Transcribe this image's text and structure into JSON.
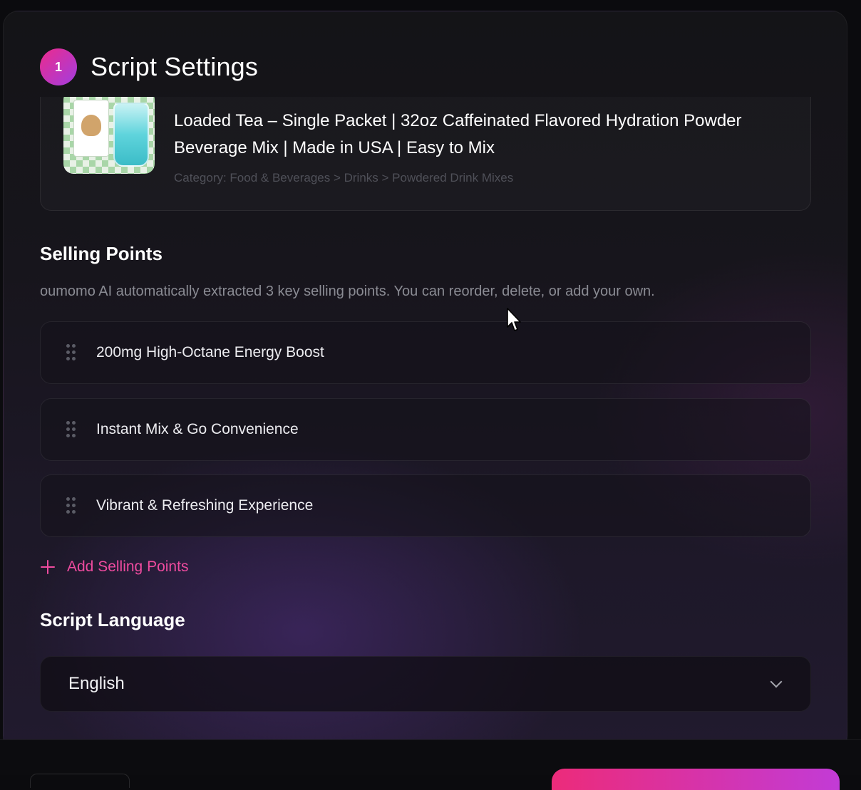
{
  "header": {
    "step_number": "1",
    "title": "Script Settings"
  },
  "product": {
    "title": "Loaded Tea – Single Packet | 32oz Caffeinated Flavored Hydration Powder Beverage Mix | Made in USA | Easy to Mix",
    "category": "Category: Food & Beverages > Drinks > Powdered Drink Mixes"
  },
  "selling_points": {
    "title": "Selling Points",
    "description": "oumomo AI automatically extracted 3 key selling points. You can reorder, delete, or add your own.",
    "items": [
      {
        "label": "200mg High-Octane Energy Boost"
      },
      {
        "label": "Instant Mix & Go Convenience"
      },
      {
        "label": "Vibrant & Refreshing Experience"
      }
    ],
    "add_label": "Add Selling Points"
  },
  "language": {
    "title": "Script Language",
    "selected": "English"
  },
  "colors": {
    "accent_pink": "#ef4b9f",
    "badge_gradient_start": "#ec2b8c",
    "badge_gradient_end": "#a23de0"
  },
  "icons": [
    "drag-handle-icon",
    "plus-icon",
    "chevron-down-icon",
    "mouse-cursor-icon"
  ]
}
